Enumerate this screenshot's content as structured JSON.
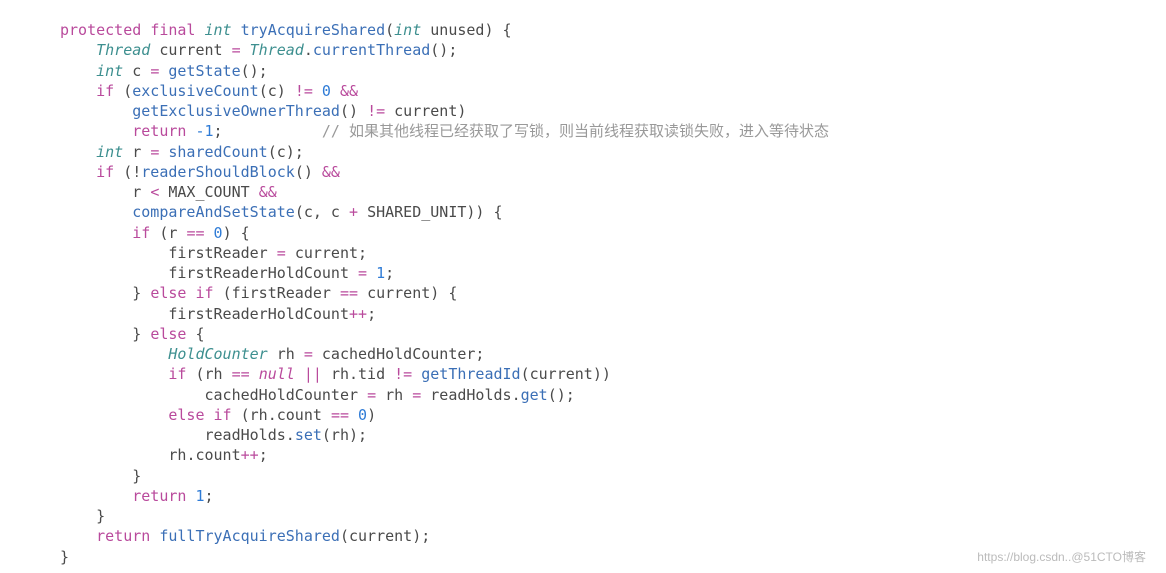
{
  "code": {
    "l1": {
      "kw1": "protected",
      "kw2": "final",
      "type": "int",
      "fn": "tryAcquireShared",
      "paren_open": "(",
      "ptype": "int",
      "param": "unused",
      "paren_close": ")",
      "brace": "{"
    },
    "l2": {
      "type": "Thread",
      "var": "current",
      "eq": "=",
      "cls": "Thread",
      "dot": ".",
      "fn": "currentThread",
      "call": "();"
    },
    "l3": {
      "type": "int",
      "var": "c",
      "eq": "=",
      "fn": "getState",
      "call": "();"
    },
    "l4": {
      "kw": "if",
      "open": "(",
      "fn": "exclusiveCount",
      "args": "(c)",
      "op": "!=",
      "num": "0",
      "and": "&&"
    },
    "l5": {
      "fn": "getExclusiveOwnerThread",
      "call": "()",
      "op": "!=",
      "id": "current)"
    },
    "l6": {
      "kw": "return",
      "num": "-1",
      "semi": ";",
      "cmt": "// 如果其他线程已经获取了写锁，则当前线程获取读锁失败，进入等待状态"
    },
    "l7": {
      "type": "int",
      "var": "r",
      "eq": "=",
      "fn": "sharedCount",
      "args": "(c);"
    },
    "l8": {
      "kw": "if",
      "open": "(!",
      "fn": "readerShouldBlock",
      "call": "()",
      "and": "&&"
    },
    "l9": {
      "id": "r",
      "op": "<",
      "const": "MAX_COUNT",
      "and": "&&"
    },
    "l10": {
      "fn": "compareAndSetState",
      "args": "(c, c",
      "plus": "+",
      "const": "SHARED_UNIT",
      "close": ")) {"
    },
    "l11": {
      "kw": "if",
      "open": "(r",
      "op": "==",
      "num": "0",
      "close": ") {"
    },
    "l12": {
      "id": "firstReader",
      "eq": "=",
      "id2": "current;"
    },
    "l13": {
      "id": "firstReaderHoldCount",
      "eq": "=",
      "num": "1",
      "semi": ";"
    },
    "l14": {
      "close": "}",
      "kw": "else if",
      "open": "(firstReader",
      "op": "==",
      "id": "current) {"
    },
    "l15": {
      "id": "firstReaderHoldCount",
      "op": "++",
      "semi": ";"
    },
    "l16": {
      "close": "}",
      "kw": "else",
      "brace": "{"
    },
    "l17": {
      "type": "HoldCounter",
      "var": "rh",
      "eq": "=",
      "id": "cachedHoldCounter;"
    },
    "l18": {
      "kw": "if",
      "open": "(rh",
      "op1": "==",
      "null": "null",
      "or": "||",
      "id": "rh",
      "dot": ".",
      "fld": "tid",
      "op2": "!=",
      "fn": "getThreadId",
      "args": "(current))"
    },
    "l19": {
      "id1": "cachedHoldCounter",
      "eq1": "=",
      "id2": "rh",
      "eq2": "=",
      "id3": "readHolds",
      "dot": ".",
      "fn": "get",
      "call": "();"
    },
    "l20": {
      "kw": "else if",
      "open": "(rh",
      "dot": ".",
      "fld": "count",
      "op": "==",
      "num": "0",
      "close": ")"
    },
    "l21": {
      "id": "readHolds",
      "dot": ".",
      "fn": "set",
      "args": "(rh);"
    },
    "l22": {
      "id": "rh",
      "dot": ".",
      "fld": "count",
      "op": "++",
      "semi": ";"
    },
    "l23": {
      "brace": "}"
    },
    "l24": {
      "kw": "return",
      "num": "1",
      "semi": ";"
    },
    "l25": {
      "brace": "}"
    },
    "l26": {
      "kw": "return",
      "fn": "fullTryAcquireShared",
      "args": "(current);"
    },
    "l27": {
      "brace": "}"
    }
  },
  "watermark": "https://blog.csdn..@51CTO博客"
}
